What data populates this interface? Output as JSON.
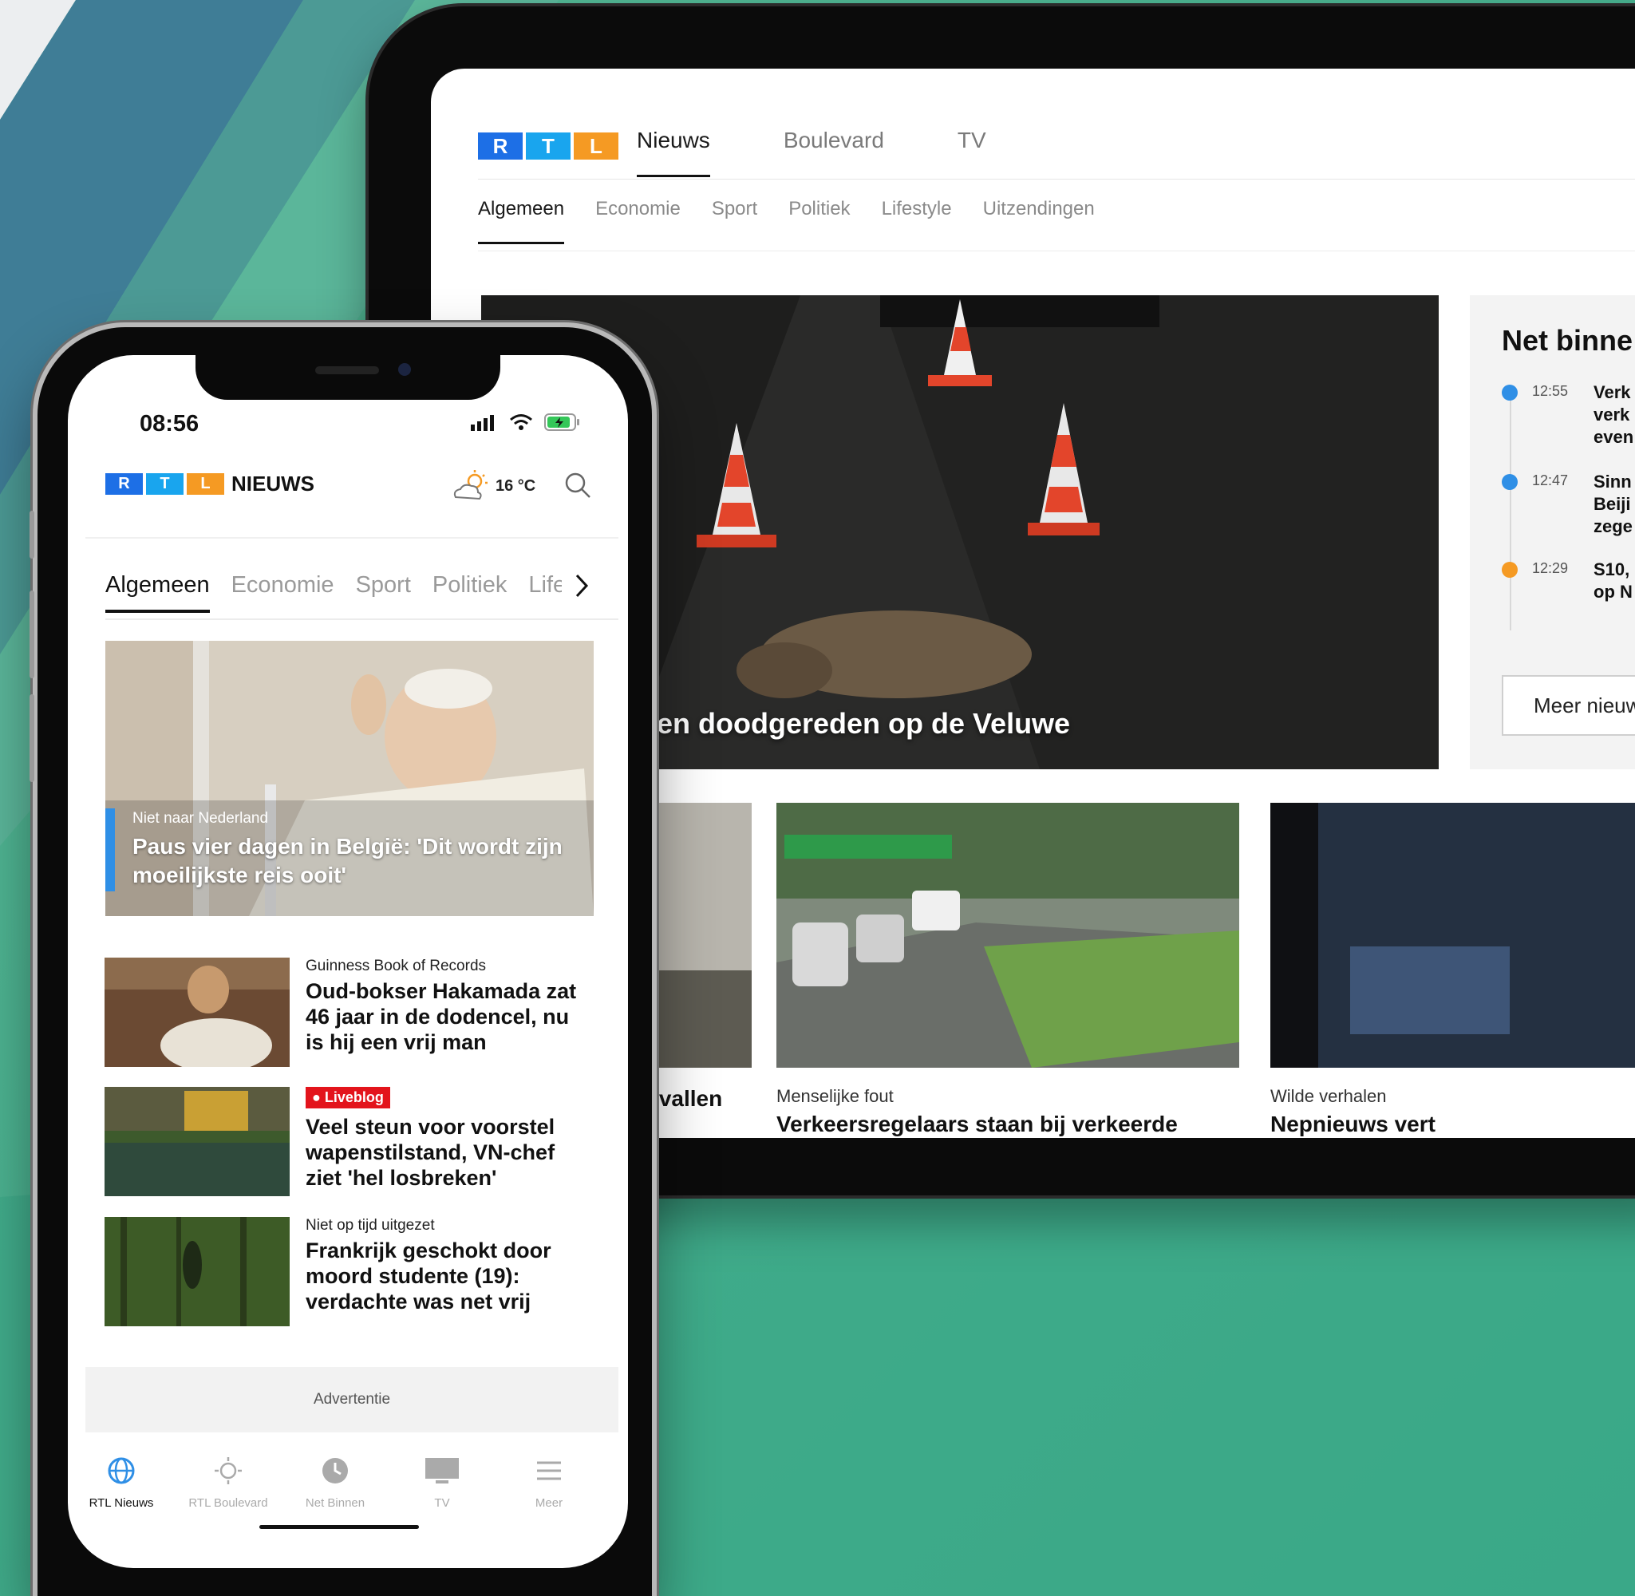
{
  "logo": {
    "letters": [
      "R",
      "T",
      "L"
    ],
    "colors": [
      "#1d6fe6",
      "#19a5ee",
      "#f59a23"
    ]
  },
  "desktop": {
    "main_nav": [
      {
        "label": "Nieuws",
        "active": true
      },
      {
        "label": "Boulevard",
        "active": false
      },
      {
        "label": "TV",
        "active": false
      }
    ],
    "sub_nav": [
      {
        "label": "Algemeen",
        "active": true
      },
      {
        "label": "Economie",
        "active": false
      },
      {
        "label": "Sport",
        "active": false
      },
      {
        "label": "Politiek",
        "active": false
      },
      {
        "label": "Lifestyle",
        "active": false
      },
      {
        "label": "Uitzendingen",
        "active": false
      }
    ],
    "hero": {
      "title": "en doodgereden op de Veluwe"
    },
    "net_binnen": {
      "title": "Net binne",
      "items": [
        {
          "time": "12:55",
          "text": "Verk\nverk\neven",
          "dot_color": "#2f8fe6"
        },
        {
          "time": "12:47",
          "text": "Sinn\nBeiji\nzege",
          "dot_color": "#2f8fe6"
        },
        {
          "time": "12:29",
          "text": "S10,\nop N",
          "dot_color": "#f59a23"
        }
      ],
      "more_button": "Meer nieuw"
    },
    "cards": [
      {
        "kicker": "",
        "title": "apenstilstand: aanvallen"
      },
      {
        "kicker": "Menselijke fout",
        "title": "Verkeersregelaars staan bij verkeerde"
      },
      {
        "kicker": "Wilde verhalen",
        "title": "Nepnieuws vert"
      }
    ]
  },
  "phone": {
    "status_time": "08:56",
    "brand_label": "NIEUWS",
    "weather": "16 °C",
    "tabs": [
      {
        "label": "Algemeen",
        "active": true
      },
      {
        "label": "Economie",
        "active": false
      },
      {
        "label": "Sport",
        "active": false
      },
      {
        "label": "Politiek",
        "active": false
      },
      {
        "label": "Lifestyle",
        "active": false
      }
    ],
    "hero": {
      "kicker": "Niet naar Nederland",
      "title": "Paus vier dagen in België: 'Dit wordt zijn moeilijkste reis ooit'"
    },
    "articles": [
      {
        "kicker": "Guinness Book of Records",
        "title": "Oud-bokser Hakamada zat 46 jaar in de dodencel, nu is hij een vrij man",
        "live": false
      },
      {
        "kicker": "Liveblog",
        "title": "Veel steun voor voorstel wapenstilstand, VN-chef ziet 'hel losbreken'",
        "live": true
      },
      {
        "kicker": "Niet op tijd uitgezet",
        "title": "Frankrijk geschokt door moord studente (19): verdachte was net vrij",
        "live": false
      }
    ],
    "ad_label": "Advertentie",
    "bottom_nav": [
      {
        "label": "RTL Nieuws",
        "icon": "globe-icon",
        "active": true
      },
      {
        "label": "RTL Boulevard",
        "icon": "sun-icon",
        "active": false
      },
      {
        "label": "Net Binnen",
        "icon": "clock-icon",
        "active": false
      },
      {
        "label": "TV",
        "icon": "tv-icon",
        "active": false
      },
      {
        "label": "Meer",
        "icon": "menu-icon",
        "active": false
      }
    ]
  }
}
